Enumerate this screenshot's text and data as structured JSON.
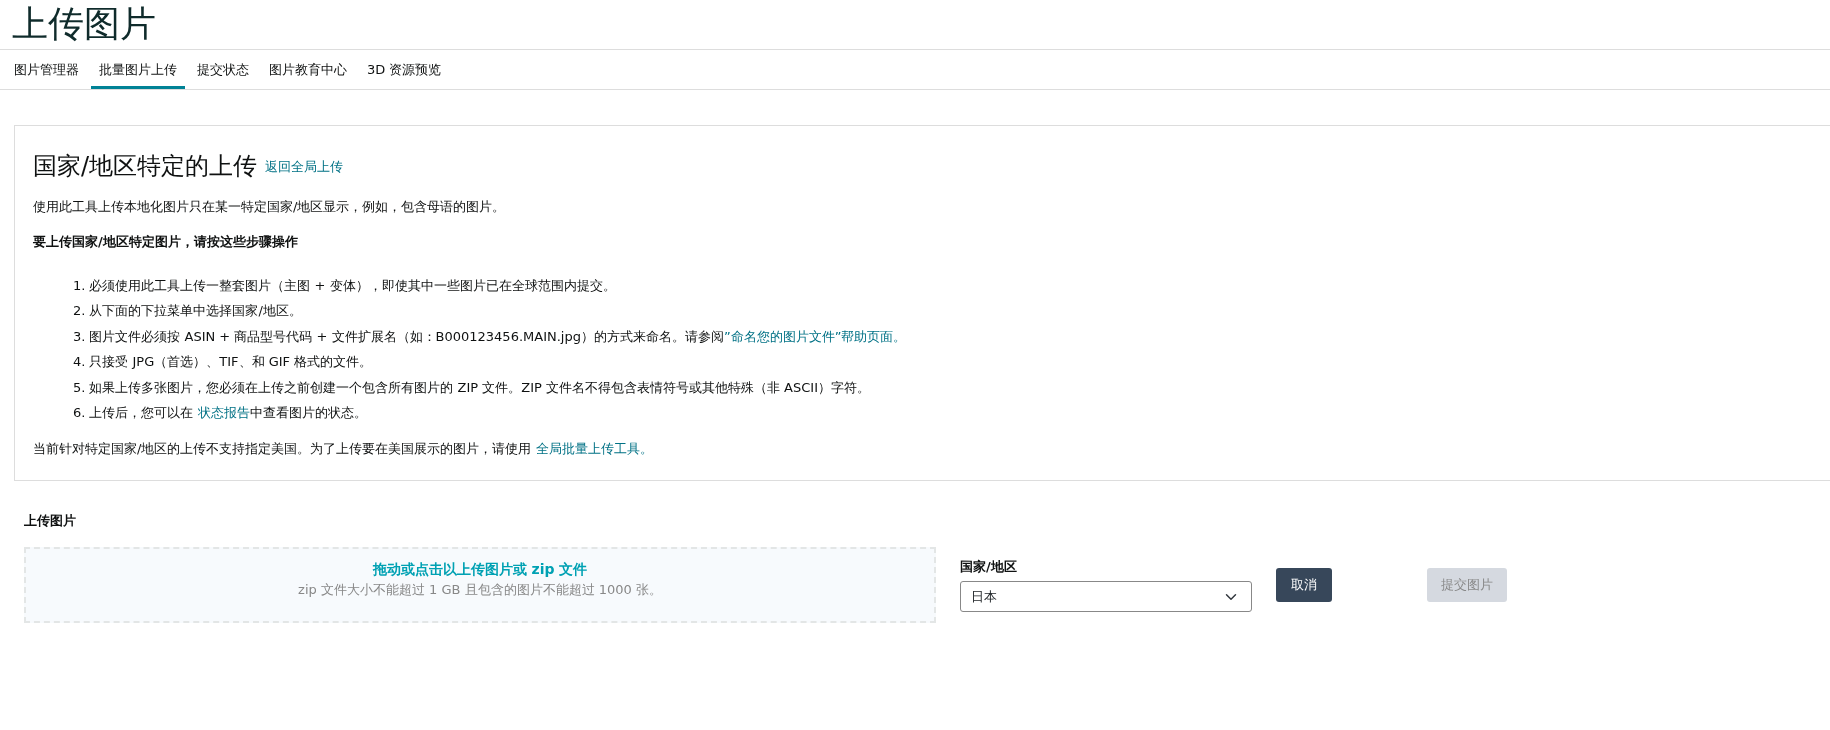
{
  "page_title": "上传图片",
  "tabs": [
    {
      "label": "图片管理器",
      "selected": false
    },
    {
      "label": "批量图片上传",
      "selected": true
    },
    {
      "label": "提交状态",
      "selected": false
    },
    {
      "label": "图片教育中心",
      "selected": false
    },
    {
      "label": "3D 资源预览",
      "selected": false
    }
  ],
  "info_panel": {
    "heading": "国家/地区特定的上传",
    "back_link": "返回全局上传",
    "intro": "使用此工具上传本地化图片只在某一特定国家/地区显示，例如，包含母语的图片。",
    "steps_title": "要上传国家/地区特定图片，请按这些步骤操作",
    "steps": [
      {
        "number": "1.",
        "parts": [
          {
            "kind": "text",
            "text": "必须使用此工具上传一整套图片（主图 + 变体），即使其中一些图片已在全球范围内提交。"
          }
        ]
      },
      {
        "number": "2.",
        "parts": [
          {
            "kind": "text",
            "text": "从下面的下拉菜单中选择国家/地区。"
          }
        ]
      },
      {
        "number": "3.",
        "parts": [
          {
            "kind": "text",
            "text": "图片文件必须按 ASIN + 商品型号代码 + 文件扩展名（如：B000123456.MAIN.jpg）的方式来命名。请参阅"
          },
          {
            "kind": "link",
            "text": "”命名您的图片文件”帮助页面。"
          }
        ]
      },
      {
        "number": "4.",
        "parts": [
          {
            "kind": "text",
            "text": "只接受 JPG（首选）、TIF、和 GIF 格式的文件。"
          }
        ]
      },
      {
        "number": "5.",
        "parts": [
          {
            "kind": "text",
            "text": "如果上传多张图片，您必须在上传之前创建一个包含所有图片的 ZIP 文件。ZIP 文件名不得包含表情符号或其他特殊（非 ASCII）字符。"
          }
        ]
      },
      {
        "number": "6.",
        "parts": [
          {
            "kind": "text",
            "text": "上传后，您可以在 "
          },
          {
            "kind": "link",
            "text": "状态报告"
          },
          {
            "kind": "text",
            "text": "中查看图片的状态。"
          }
        ]
      }
    ],
    "note": [
      {
        "kind": "text",
        "text": "当前针对特定国家/地区的上传不支持指定美国。为了上传要在美国展示的图片，请使用 "
      },
      {
        "kind": "link",
        "text": "全局批量上传工具。"
      }
    ]
  },
  "upload": {
    "label": "上传图片",
    "drop_title": "拖动或点击以上传图片或 zip 文件",
    "drop_hint": "zip 文件大小不能超过 1 GB 且包含的图片不能超过 1000 张。",
    "country_label": "国家/地区",
    "country_value": "日本",
    "buttons": [
      {
        "label": "取消",
        "disabled": false
      },
      {
        "label": "提交图片",
        "disabled": true
      }
    ]
  }
}
